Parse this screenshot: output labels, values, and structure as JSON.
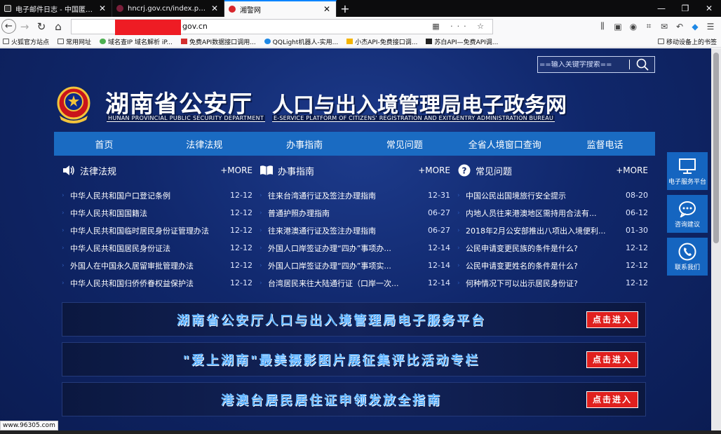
{
  "browser": {
    "tabs": [
      {
        "title": "电子邮件日志 - 中国匿名者论坛",
        "active": false
      },
      {
        "title": "hncrj.gov.cn/index.php?m=",
        "active": false
      },
      {
        "title": "湘警网",
        "active": true
      }
    ],
    "new_tab": "+",
    "url_suffix": "gov.cn",
    "bookmarks": [
      {
        "label": "火狐官方站点",
        "icon": "folder-icon"
      },
      {
        "label": "常用网址",
        "icon": "folder-icon"
      },
      {
        "label": "域名查IP 域名解析 iP...",
        "icon": "globe-icon"
      },
      {
        "label": "免费API数据接口调用...",
        "icon": "api-icon"
      },
      {
        "label": "QQLight机器人-实用...",
        "icon": "qq-icon"
      },
      {
        "label": "小杰API-免费接口调...",
        "icon": "star-icon"
      },
      {
        "label": "苏白API—免费API调...",
        "icon": "api-icon"
      }
    ],
    "mobile_bookmarks": "移动设备上的书签",
    "status_url": "www.96305.com"
  },
  "site": {
    "search_placeholder": "==输入关键字搜索==",
    "title_cn_1": "湖南省公安厅",
    "title_cn_2": "人口与出入境管理局电子政务网",
    "title_en_1": "HUNAN PROVINCIAL PUBLIC SECURITY DEPARTMENT",
    "title_en_2": "E-SERVICE PLATFORM OF CITIZENS' REGISTRATION AND EXIT&ENTRY ADMINISTRATION BUREAU",
    "nav": [
      "首页",
      "法律法规",
      "办事指南",
      "常见问题",
      "全省人境窗口查询",
      "监督电话"
    ],
    "columns": [
      {
        "title": "法律法规",
        "icon": "speaker-icon",
        "more": "+MORE",
        "items": [
          {
            "text": "中华人民共和国户口登记条例",
            "date": "12-12"
          },
          {
            "text": "中华人民共和国国籍法",
            "date": "12-12"
          },
          {
            "text": "中华人民共和国临时居民身份证管理办法",
            "date": "12-12"
          },
          {
            "text": "中华人民共和国居民身份证法",
            "date": "12-12"
          },
          {
            "text": "外国人在中国永久居留审批管理办法",
            "date": "12-12"
          },
          {
            "text": "中华人民共和国归侨侨眷权益保护法",
            "date": "12-12"
          }
        ]
      },
      {
        "title": "办事指南",
        "icon": "book-icon",
        "more": "+MORE",
        "items": [
          {
            "text": "往来台湾通行证及签注办理指南",
            "date": "12-31"
          },
          {
            "text": "普通护照办理指南",
            "date": "06-27"
          },
          {
            "text": "往来港澳通行证及签注办理指南",
            "date": "06-27"
          },
          {
            "text": "外国人口岸签证办理“四办”事项办...",
            "date": "12-14"
          },
          {
            "text": "外国人口岸签证办理“四办”事项实...",
            "date": "12-14"
          },
          {
            "text": "台湾居民来往大陆通行证（口岸一次...",
            "date": "12-14"
          }
        ]
      },
      {
        "title": "常见问题",
        "icon": "question-icon",
        "more": "+MORE",
        "items": [
          {
            "text": "中国公民出国境旅行安全提示",
            "date": "08-20"
          },
          {
            "text": "内地人员往来港澳地区需持用合法有...",
            "date": "06-12"
          },
          {
            "text": "2018年2月公安部推出八项出入境便利...",
            "date": "01-30"
          },
          {
            "text": "公民申请变更民族的条件是什么?",
            "date": "12-12"
          },
          {
            "text": "公民申请变更姓名的条件是什么?",
            "date": "12-12"
          },
          {
            "text": "何种情况下可以出示居民身份证?",
            "date": "12-12"
          }
        ]
      }
    ],
    "banners": [
      {
        "text": "湖南省公安厅人口与出入境管理局电子服务平台",
        "button": "点击进入"
      },
      {
        "text": "\"爱上湖南\"最美摄影图片展征集评比活动专栏",
        "button": "点击进入"
      },
      {
        "text": "港澳台居民居住证申领发放全指南",
        "button": "点击进入"
      }
    ],
    "side_buttons": [
      {
        "label": "电子服务平台",
        "icon": "monitor-icon"
      },
      {
        "label": "咨询建议",
        "icon": "chat-icon"
      },
      {
        "label": "联系我们",
        "icon": "phone-icon"
      }
    ]
  }
}
